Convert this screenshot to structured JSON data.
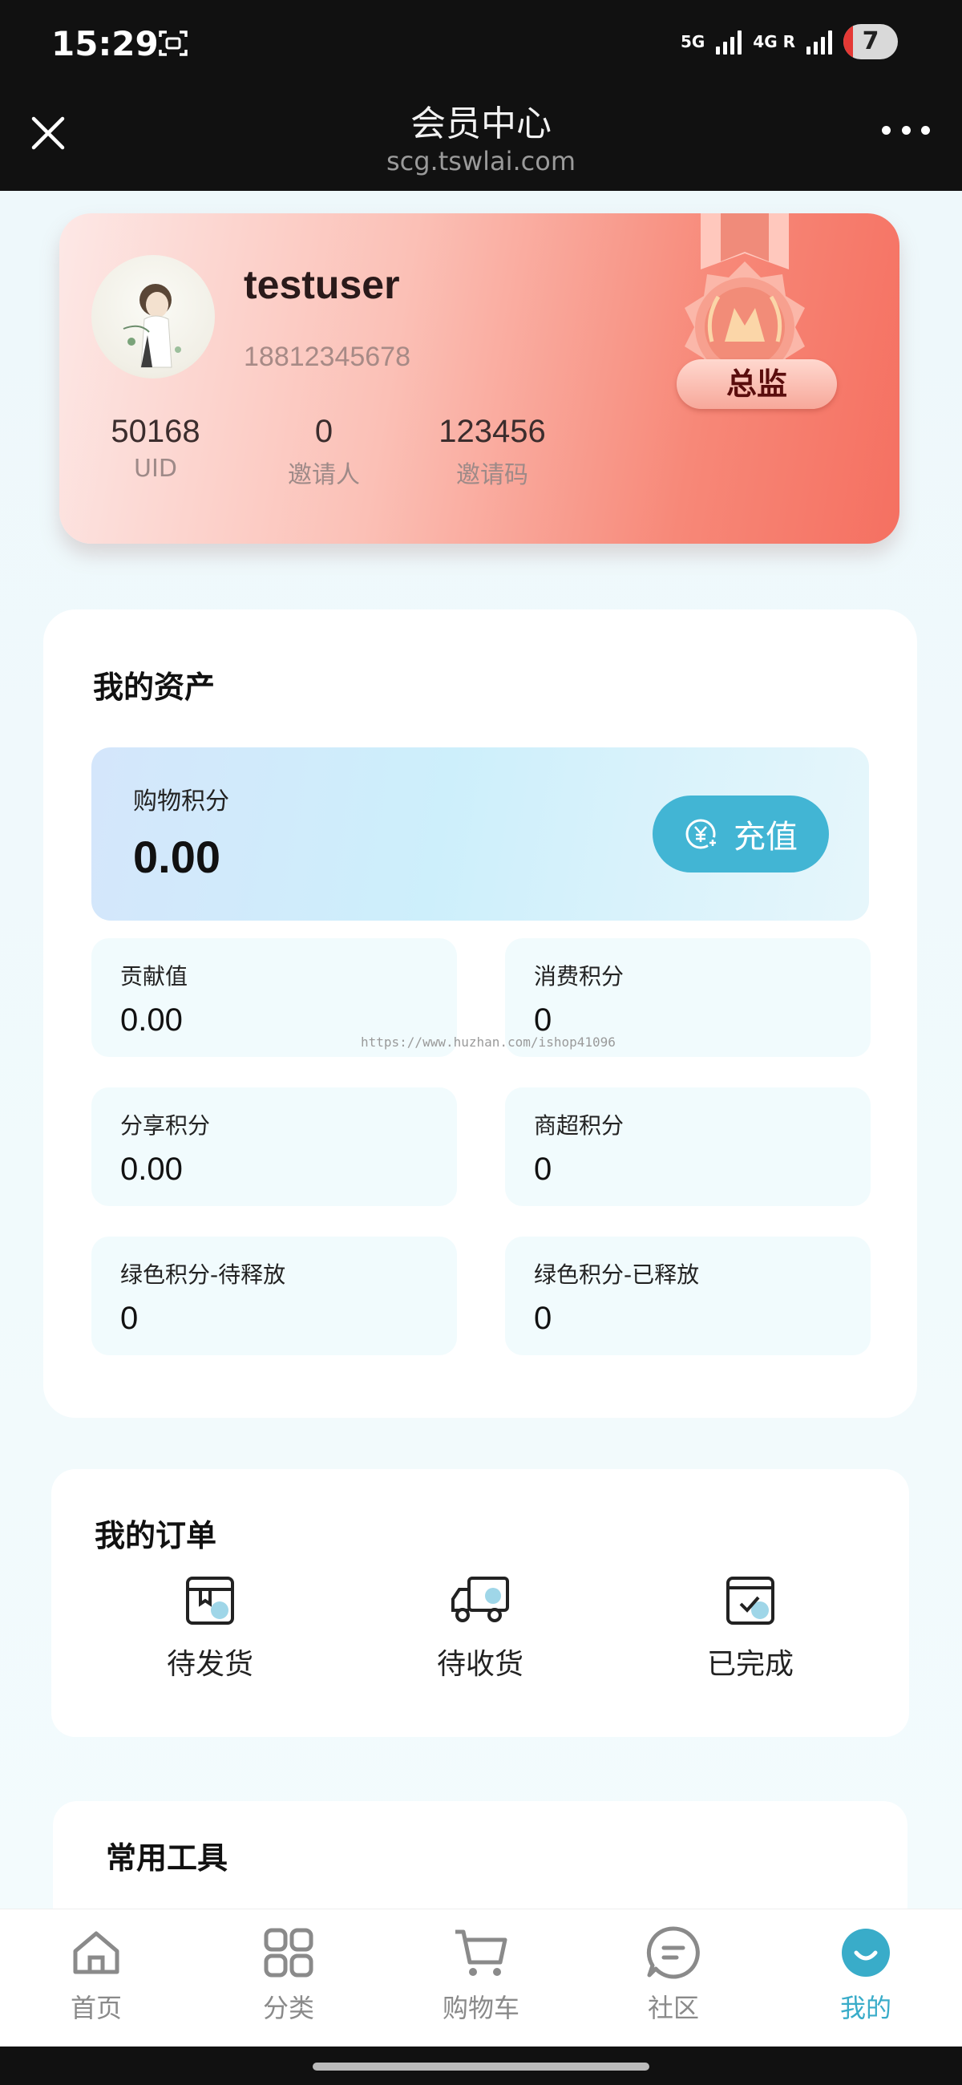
{
  "status_bar": {
    "time": "15:29",
    "network1": "5G",
    "network2": "4G R",
    "battery": "7"
  },
  "header": {
    "title": "会员中心",
    "url": "scg.tswlai.com"
  },
  "profile": {
    "username": "testuser",
    "phone": "18812345678",
    "level": "总监",
    "stats": [
      {
        "value": "50168",
        "label": "UID"
      },
      {
        "value": "0",
        "label": "邀请人"
      },
      {
        "value": "123456",
        "label": "邀请码"
      }
    ]
  },
  "assets": {
    "title": "我的资产",
    "shopping_points": {
      "label": "购物积分",
      "value": "0.00"
    },
    "recharge_label": "充值",
    "items": [
      {
        "label": "贡献值",
        "value": "0.00"
      },
      {
        "label": "消费积分",
        "value": "0"
      },
      {
        "label": "分享积分",
        "value": "0.00"
      },
      {
        "label": "商超积分",
        "value": "0"
      },
      {
        "label": "绿色积分-待释放",
        "value": "0"
      },
      {
        "label": "绿色积分-已释放",
        "value": "0"
      }
    ],
    "watermark": "https://www.huzhan.com/ishop41096"
  },
  "orders": {
    "title": "我的订单",
    "items": [
      {
        "label": "待发货",
        "icon": "package-icon"
      },
      {
        "label": "待收货",
        "icon": "truck-icon"
      },
      {
        "label": "已完成",
        "icon": "check-box-icon"
      }
    ]
  },
  "tools": {
    "title": "常用工具"
  },
  "tabbar": {
    "accent_color": "#39acc9",
    "items": [
      {
        "label": "首页",
        "icon": "home-icon"
      },
      {
        "label": "分类",
        "icon": "grid-icon"
      },
      {
        "label": "购物车",
        "icon": "cart-icon"
      },
      {
        "label": "社区",
        "icon": "chat-icon"
      },
      {
        "label": "我的",
        "icon": "profile-icon",
        "active": true
      }
    ]
  }
}
